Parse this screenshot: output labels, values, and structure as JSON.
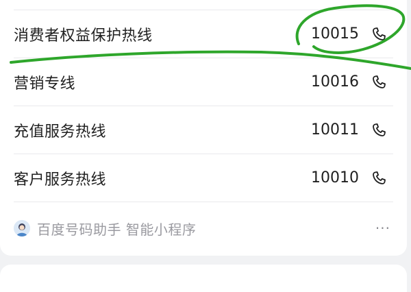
{
  "hotlines": [
    {
      "label": "消费者权益保护热线",
      "number": "10015",
      "icon": "phone-icon"
    },
    {
      "label": "营销专线",
      "number": "10016",
      "icon": "phone-icon"
    },
    {
      "label": "充值服务热线",
      "number": "10011",
      "icon": "phone-icon"
    },
    {
      "label": "客户服务热线",
      "number": "10010",
      "icon": "phone-icon"
    }
  ],
  "footer": {
    "source": "百度号码助手 智能小程序",
    "more": "···",
    "avatar_icon": "assistant-avatar-icon",
    "more_icon": "more-options-icon"
  },
  "colors": {
    "annotation": "#2ea62b",
    "background": "#f1f2f4",
    "card": "#ffffff",
    "text": "#1f1f1f",
    "muted": "#9a9aa0"
  }
}
